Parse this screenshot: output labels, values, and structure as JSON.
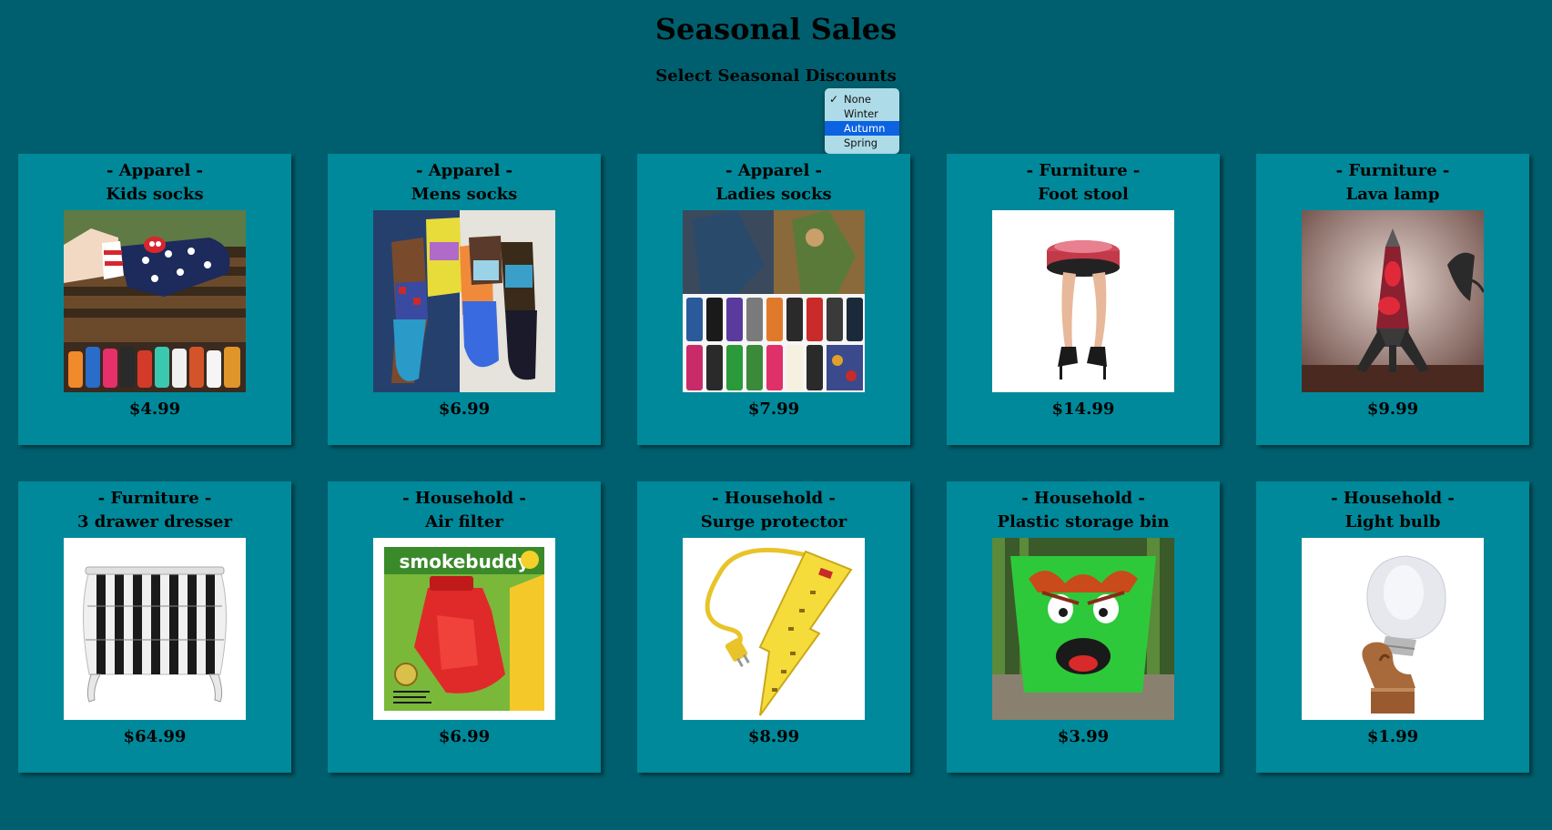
{
  "title": "Seasonal Sales",
  "discount_label": "Select Seasonal Discounts",
  "discount_options": [
    "None",
    "Winter",
    "Autumn",
    "Spring"
  ],
  "products": [
    {
      "category": "- Apparel -",
      "name": "Kids socks",
      "price": "$4.99"
    },
    {
      "category": "- Apparel -",
      "name": "Mens socks",
      "price": "$6.99"
    },
    {
      "category": "- Apparel -",
      "name": "Ladies socks",
      "price": "$7.99"
    },
    {
      "category": "- Furniture -",
      "name": "Foot stool",
      "price": "$14.99"
    },
    {
      "category": "- Furniture -",
      "name": "Lava lamp",
      "price": "$9.99"
    },
    {
      "category": "- Furniture -",
      "name": "3 drawer dresser",
      "price": "$64.99"
    },
    {
      "category": "- Household -",
      "name": "Air filter",
      "price": "$6.99"
    },
    {
      "category": "- Household -",
      "name": "Surge protector",
      "price": "$8.99"
    },
    {
      "category": "- Household -",
      "name": "Plastic storage bin",
      "price": "$3.99"
    },
    {
      "category": "- Household -",
      "name": "Light bulb",
      "price": "$1.99"
    }
  ],
  "air_filter_brand": "smokebuddy"
}
